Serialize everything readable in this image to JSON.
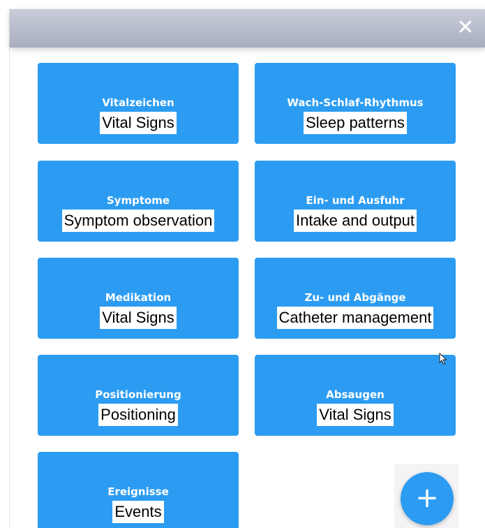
{
  "header": {
    "close_icon": "✕"
  },
  "tiles": [
    {
      "title": "Vitalzeichen",
      "subtitle": "Vital Signs"
    },
    {
      "title": "Wach-Schlaf-Rhythmus",
      "subtitle": "Sleep patterns"
    },
    {
      "title": "Symptome",
      "subtitle": "Symptom observation"
    },
    {
      "title": "Ein- und Ausfuhr",
      "subtitle": "Intake and output"
    },
    {
      "title": "Medikation",
      "subtitle": "Vital Signs"
    },
    {
      "title": "Zu- und Abgänge",
      "subtitle": "Catheter management"
    },
    {
      "title": "Positionierung",
      "subtitle": "Positioning"
    },
    {
      "title": "Absaugen",
      "subtitle": "Vital Signs"
    },
    {
      "title": "Ereignisse",
      "subtitle": "Events"
    }
  ],
  "fab": {
    "label": "+"
  },
  "colors": {
    "tile": "#2c9cf2",
    "header": "#b3b8c8"
  }
}
